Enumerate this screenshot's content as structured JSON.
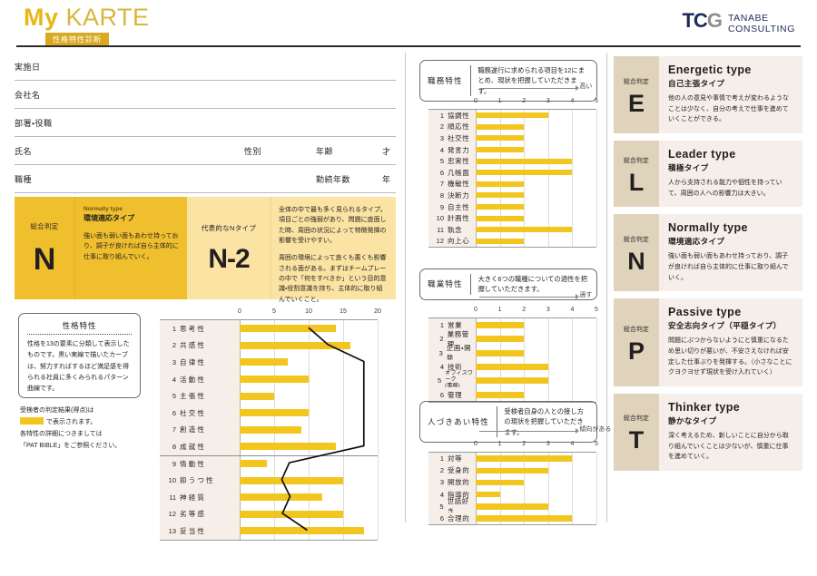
{
  "header": {
    "logo_my": "My",
    "logo_karte": "KARTE",
    "logo_subtitle": "性格特性診断",
    "brand_mark_tc": "TC",
    "brand_mark_g": "G",
    "brand_line1": "TANABE",
    "brand_line2": "CONSULTING"
  },
  "form": {
    "rows": [
      {
        "label": "実施日"
      },
      {
        "label": "会社名"
      },
      {
        "label": "部署・役職"
      },
      {
        "label": "氏名",
        "mid": "性別",
        "r1": "年齢",
        "r2": "才"
      },
      {
        "label": "職種",
        "r1": "勤続年数",
        "r2": "年"
      }
    ]
  },
  "summary": {
    "judgement_caption": "総合判定",
    "judgement_letter": "N",
    "type_en": "Normally type",
    "type_ja": "環境適応タイプ",
    "type_desc": "強い面も弱い面もあわせ持っており、調子が良ければ自ら主体的に仕事に取り組んでいく。",
    "subtype_caption": "代表的なNタイプ",
    "subtype_letter": "N-2",
    "subtype_desc1": "全体の中で最も多く見られるタイプ。項目ごとの強弱があり、問題に直面した時、周囲の状況によって特徴発揮の影響を受けやすい。",
    "subtype_desc2": "周囲の環境によって良くも悪くも影響される面がある。まずはチームプレーの中で「何をすべきか」という目的意識・役割意識を持ち、主体的に取り組んでいくこと。"
  },
  "note": {
    "title": "性格特性",
    "body": "性格を13の要素に分類して表示したものです。黒い実線で描いたカーブは、努力すればするほど満足感を得られる社員に多くみられるパターン曲線です。"
  },
  "legend": {
    "line1": "受検者の判定結果(得点)は",
    "line2": "で表示されます。",
    "line3": "各特性の詳細につきましては",
    "line4": "「PAT BIBLE」をご参照ください。",
    "chip_color": "#F2C61F"
  },
  "sections": {
    "job": {
      "title": "職務特性",
      "desc": "職務遂行に求められる項目を12にまとめ、現状を把握していただきます。",
      "arrow_label": "高い"
    },
    "occupation": {
      "title": "職業特性",
      "desc": "大きく6つの職種についての適性を把握していただきます。",
      "arrow_label": "適す"
    },
    "social": {
      "title": "人づきあい特性",
      "desc": "受検者自身の人との接し方の現状を把握していただきます。",
      "arrow_label": "傾向がある"
    }
  },
  "chart_data": [
    {
      "id": "personality",
      "type": "bar",
      "title": "性格特性",
      "orientation": "horizontal",
      "xlabel": "",
      "ylabel": "",
      "xlim": [
        0,
        20
      ],
      "ticks": [
        0,
        5,
        10,
        15,
        20
      ],
      "grid": true,
      "bar_color": "#F2C61F",
      "categories": [
        "思考性",
        "共感性",
        "自律性",
        "活動性",
        "主張性",
        "社交性",
        "創造性",
        "成就性",
        "情動性",
        "抑うつ性",
        "神経質",
        "劣等感",
        "妥当性"
      ],
      "values": [
        14,
        16,
        7,
        10,
        5,
        10,
        9,
        14,
        4,
        15,
        12,
        15,
        18
      ],
      "overlay_curve": {
        "name": "パターン曲線",
        "color": "#111111",
        "values": [
          10,
          12.8,
          18,
          18,
          18,
          18,
          18,
          18,
          7.2,
          6.1,
          7.3,
          6.2,
          9.8
        ]
      },
      "group_divider_after": 8
    },
    {
      "id": "job",
      "type": "bar",
      "title": "職務特性",
      "orientation": "horizontal",
      "xlim": [
        0,
        5
      ],
      "ticks": [
        0,
        1,
        2,
        3,
        4,
        5
      ],
      "grid": true,
      "bar_color": "#F2C61F",
      "categories": [
        "協調性",
        "順応性",
        "社交性",
        "発言力",
        "忠実性",
        "几帳面",
        "機敏性",
        "決断力",
        "自主性",
        "計画性",
        "執念",
        "向上心"
      ],
      "values": [
        3,
        2,
        2,
        2,
        4,
        4,
        2,
        2,
        2,
        2,
        4,
        2
      ]
    },
    {
      "id": "occupation",
      "type": "bar",
      "title": "職業特性",
      "orientation": "horizontal",
      "xlim": [
        0,
        5
      ],
      "ticks": [
        0,
        1,
        2,
        3,
        4,
        5
      ],
      "grid": true,
      "bar_color": "#F2C61F",
      "categories": [
        "営業",
        "業務管理",
        "企画・開発",
        "技術",
        "オフィスワーク\n(事務)",
        "管理"
      ],
      "values": [
        2,
        2,
        2,
        3,
        3,
        2
      ]
    },
    {
      "id": "social",
      "type": "bar",
      "title": "人づきあい特性",
      "orientation": "horizontal",
      "xlim": [
        0,
        5
      ],
      "ticks": [
        0,
        1,
        2,
        3,
        4,
        5
      ],
      "grid": true,
      "bar_color": "#F2C61F",
      "categories": [
        "対等",
        "受身的",
        "開放的",
        "指導的",
        "世話好き",
        "合理的"
      ],
      "values": [
        4,
        3,
        2,
        1,
        3,
        4
      ]
    }
  ],
  "types": [
    {
      "caption": "総合判定",
      "letter": "E",
      "en": "Energetic type",
      "ja": "自己主張タイプ",
      "desc": "他の人の意見や事情で考えが変わるようなことは少なく、自分の考えで仕事を進めていくことができる。"
    },
    {
      "caption": "総合判定",
      "letter": "L",
      "en": "Leader type",
      "ja": "積極タイプ",
      "desc": "人から支持される能力や個性を持っていて、周囲の人への影響力は大きい。"
    },
    {
      "caption": "総合判定",
      "letter": "N",
      "en": "Normally type",
      "ja": "環境適応タイプ",
      "desc": "強い面も弱い面もあわせ持っており、調子が良ければ自ら主体的に仕事に取り組んでいく。"
    },
    {
      "caption": "総合判定",
      "letter": "P",
      "en": "Passive type",
      "ja": "安全志向タイプ（平穏タイプ）",
      "desc": "問題にぶつからないようにと慎重になるため思い切りが悪いが、不安さえなければ安定した仕事ぶりを発揮する。（小さなことにクヨクヨせず現状を受け入れていく）"
    },
    {
      "caption": "総合判定",
      "letter": "T",
      "en": "Thinker type",
      "ja": "静かなタイプ",
      "desc": "深く考えるため、新しいことに自分から取り組んでいくことは少ないが、慎重に仕事を進めていく。"
    }
  ]
}
